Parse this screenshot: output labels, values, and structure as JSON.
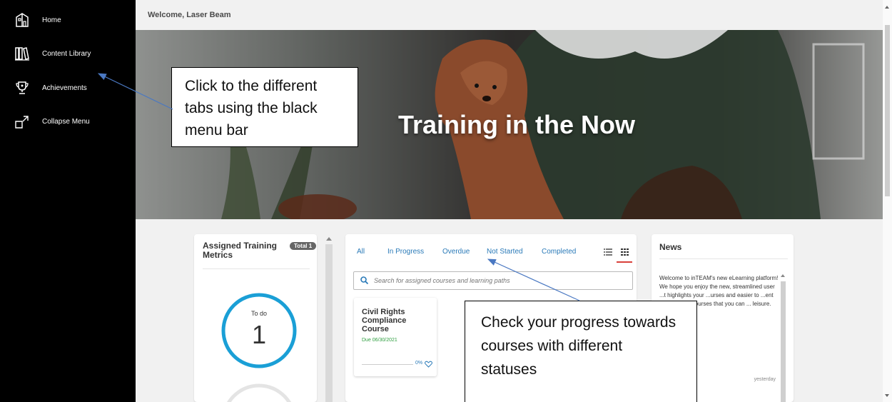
{
  "sidebar": {
    "items": [
      {
        "label": "Home",
        "icon": "home-icon"
      },
      {
        "label": "Content Library",
        "icon": "library-icon"
      },
      {
        "label": "Achievements",
        "icon": "trophy-icon"
      },
      {
        "label": "Collapse Menu",
        "icon": "collapse-icon"
      }
    ]
  },
  "header": {
    "welcome": "Welcome, Laser Beam"
  },
  "hero": {
    "title": "Training in the Now"
  },
  "metrics": {
    "title": "Assigned Training Metrics",
    "total_badge": "Total 1",
    "todo_label": "To do",
    "todo_count": "1"
  },
  "courses": {
    "tabs": [
      "All",
      "In Progress",
      "Overdue",
      "Not Started",
      "Completed"
    ],
    "search_placeholder": "Search for assigned courses and learning paths",
    "card": {
      "title": "Civil Rights Compliance Course",
      "due": "Due 06/30/2021",
      "progress_label": "0%",
      "progress": 0
    }
  },
  "news": {
    "title": "News",
    "text": "Welcome to inTEAM's new eLearning platform! We hope you enjoy the new, streamlined user ...t highlights your ...urses and easier to ...ent Library with ...ourses that you can ... leisure.",
    "timestamp": "yesterday"
  },
  "annotations": {
    "callout1": "Click to the different tabs using the black menu bar",
    "callout2": "Check your progress towards courses with different statuses"
  },
  "colors": {
    "sidebar": "#000000",
    "accent_blue": "#2a7ab8",
    "due_green": "#2e9e3f",
    "todo_ring": "#1a9fd6",
    "arrow": "#4a78c2"
  }
}
